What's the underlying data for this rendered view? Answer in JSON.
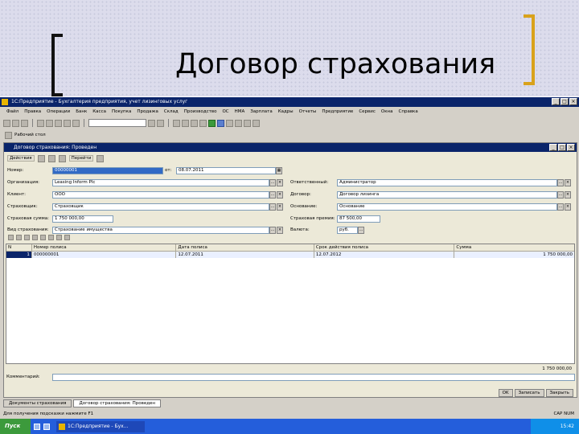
{
  "slide": {
    "title": "Договор страхования"
  },
  "app": {
    "title": "1С:Предприятие - Бухгалтерия предприятия, учет лизинговых услуг",
    "menu": [
      "Файл",
      "Правка",
      "Операции",
      "Банк",
      "Касса",
      "Покупка",
      "Продажа",
      "Склад",
      "Производство",
      "ОС",
      "НМА",
      "Зарплата",
      "Кадры",
      "Отчеты",
      "Предприятие",
      "Сервис",
      "Окна",
      "Справка"
    ],
    "toolbar2": [
      "Рабочий стол"
    ]
  },
  "doc": {
    "title": "Договор страхования: Проведен",
    "actions": [
      "Действия",
      "Перейти"
    ],
    "fields": {
      "number_label": "Номер:",
      "number_value": "00000001",
      "date_label": "от:",
      "date_value": "08.07.2011",
      "org_label": "Организация:",
      "org_value": "Leasing Inform Plc",
      "client_label": "Клиент:",
      "client_value": "ООО",
      "insurer_label": "Страховщик:",
      "insurer_value": "Страховщик",
      "sum_label": "Страховая сумма:",
      "sum_value": "1 750 000,00",
      "kind_label": "Вид страхования:",
      "kind_value": "Страхование имущества",
      "resp_label": "Ответственный:",
      "resp_value": "Администратор",
      "contract_label": "Договор:",
      "contract_value": "Договор лизинга",
      "object_label": "Основание:",
      "object_value": "Основание",
      "premium_label": "Страховая премия:",
      "premium_value": "87 500,00",
      "currency_label": "Валюта:",
      "currency_value": "руб."
    },
    "grid": {
      "headers": [
        "N",
        "Номер полиса",
        "Дата полиса",
        "Срок действия полиса",
        "Сумма"
      ],
      "rows": [
        {
          "n": "1",
          "policy": "000000001",
          "date": "12.07.2011",
          "term": "12.07.2012",
          "sum": "1 750 000,00"
        }
      ],
      "total": "1 750 000,00"
    },
    "comment_label": "Комментарий:",
    "buttons": [
      "OK",
      "Записать",
      "Закрыть"
    ]
  },
  "tasks": [
    "Документы страхования",
    "Договор страхования: Проведен"
  ],
  "status": {
    "left": "Для получения подсказки нажмите F1",
    "right": "CAP NUM"
  },
  "taskbar": {
    "start": "Пуск",
    "app": "1С:Предприятие - Бух...",
    "tray": "15:42"
  }
}
